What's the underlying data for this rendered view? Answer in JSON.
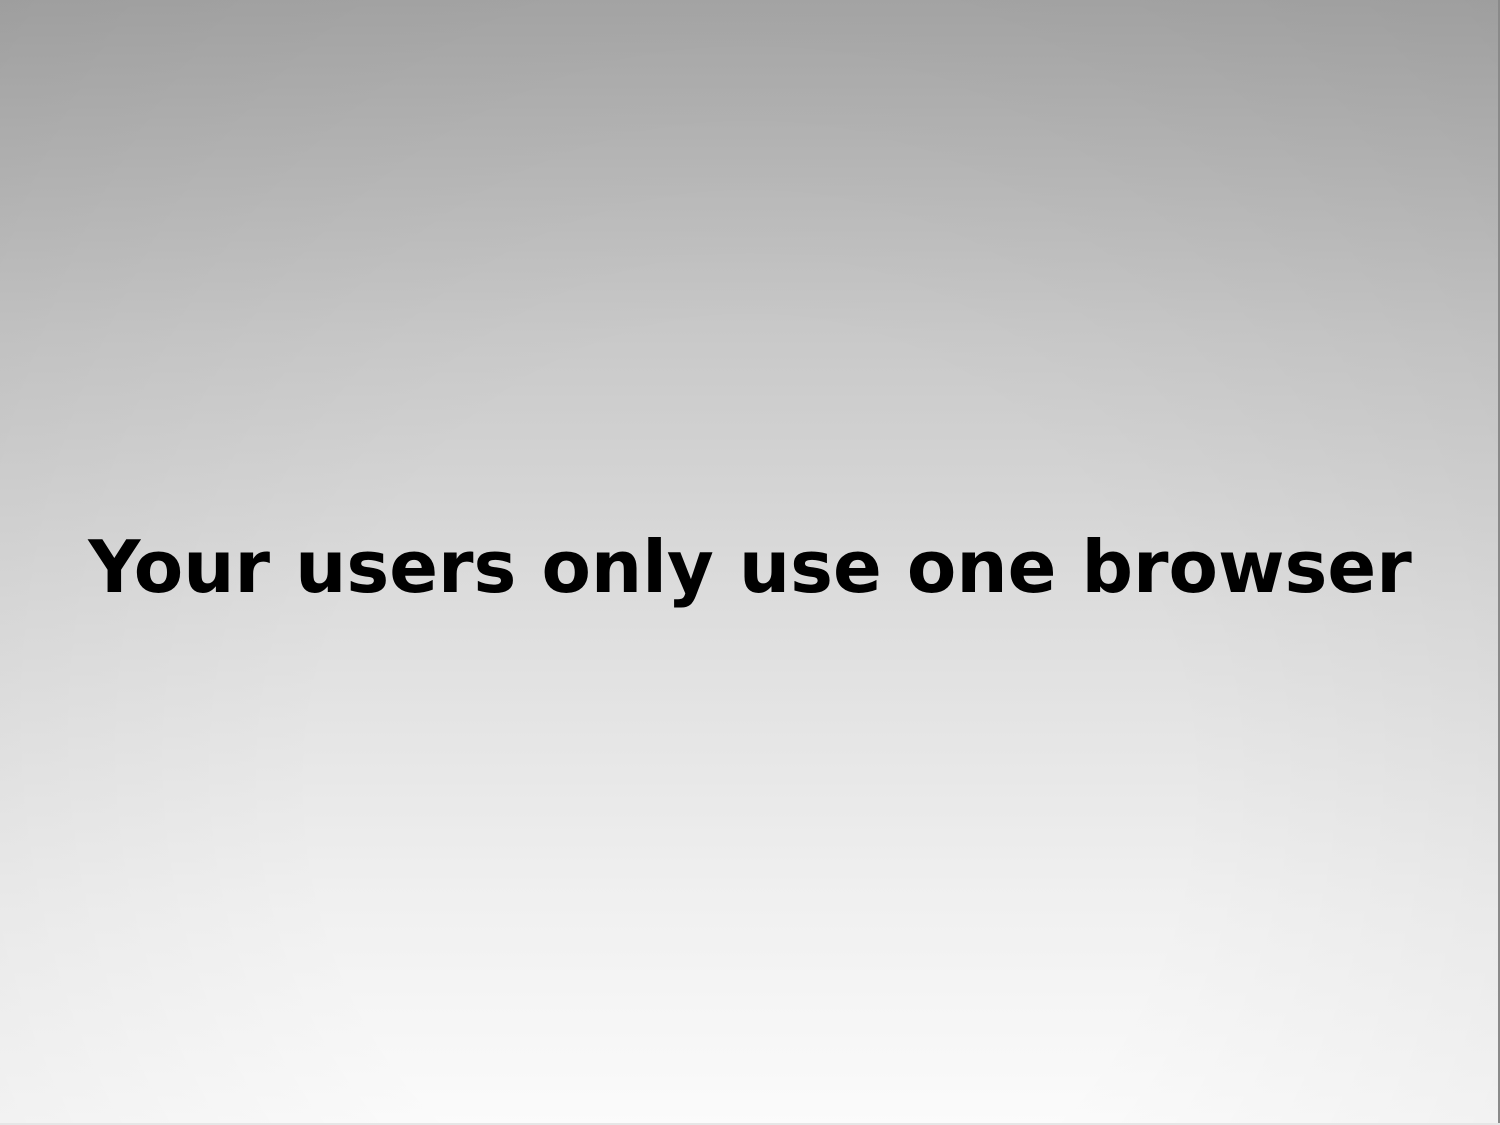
{
  "slide": {
    "headline": "Your users only use one browser"
  },
  "colors": {
    "background_top": "#a8a8a8",
    "background_bottom": "#fbfbfb",
    "text": "#000000"
  }
}
